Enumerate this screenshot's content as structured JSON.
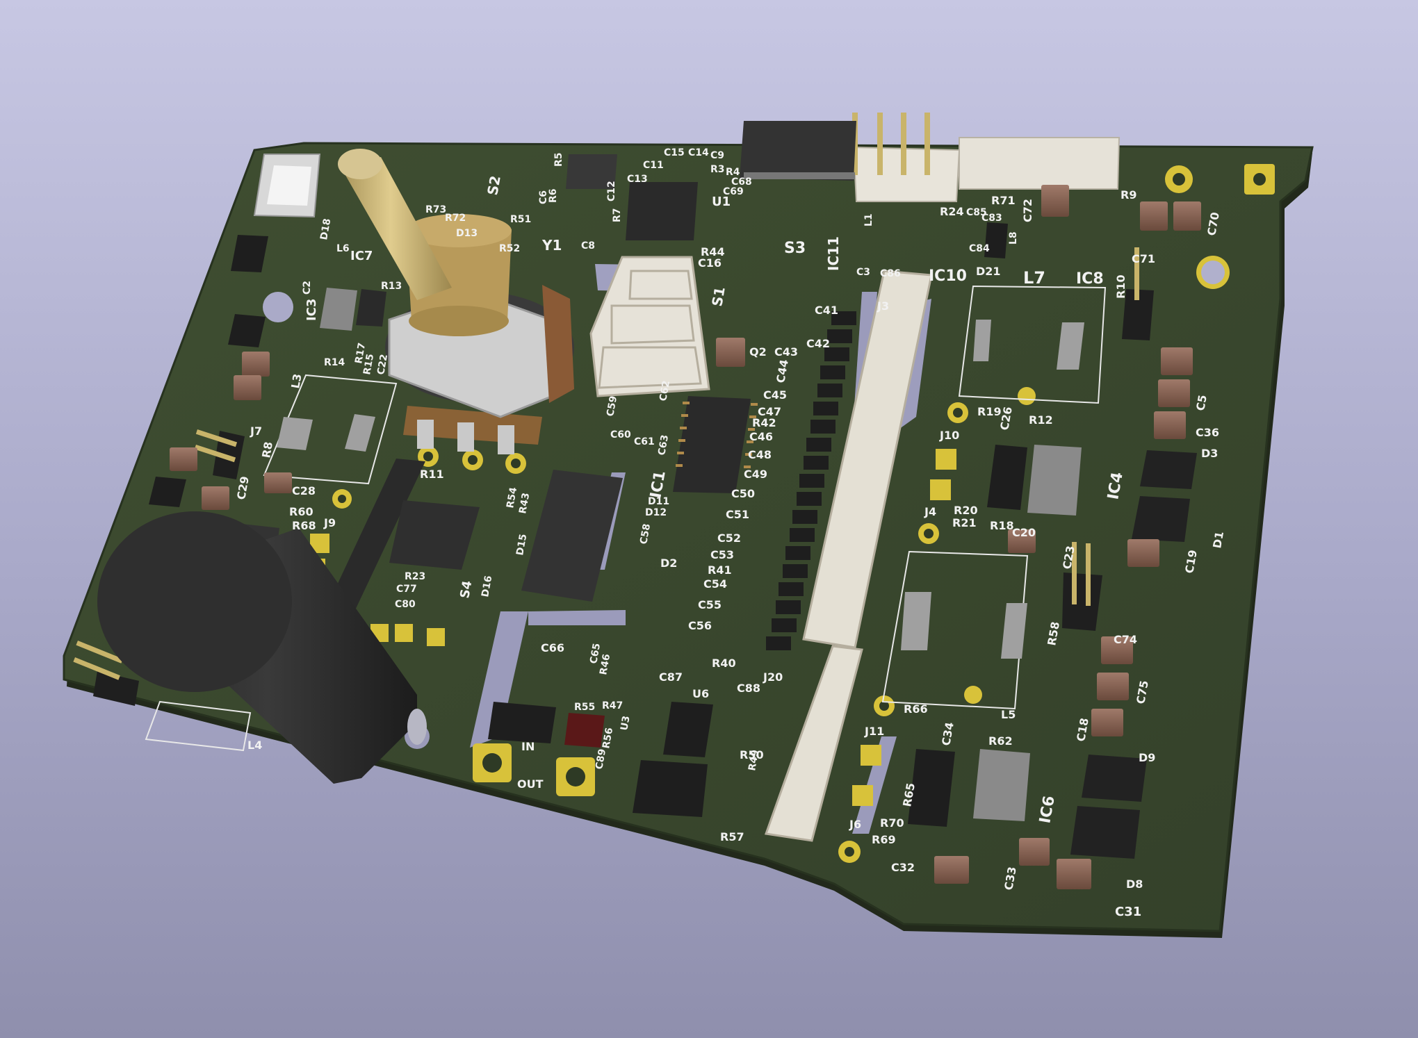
{
  "scene": {
    "subject": "",
    "colors": {
      "background_top": "#c7c7e3",
      "background_bottom": "#8f8fad",
      "board": "#3b4a2e",
      "board_edge": "#27321f",
      "silkscreen": "#f2f2f2",
      "pad_gold": "#d8c23a",
      "connector_white": "#e8e4da",
      "ic_black": "#2a2a2a",
      "capacitor_brown": "#7a5a4a",
      "knob_brass": "#c8b47a",
      "cylinder_black": "#2b2b2b"
    }
  },
  "silkscreen_labels": [
    "S2",
    "R5",
    "C15",
    "C14",
    "C9",
    "C11",
    "C13",
    "C12",
    "R3",
    "R4",
    "C68",
    "C69",
    "U1",
    "R73",
    "R72",
    "D13",
    "R51",
    "R52",
    "Y1",
    "C8",
    "R7",
    "R6",
    "C6",
    "R44",
    "C16",
    "S3",
    "IC11",
    "C3",
    "C86",
    "IC10",
    "D21",
    "L7",
    "IC8",
    "R71",
    "R24",
    "C85",
    "C83",
    "C72",
    "C84",
    "R9",
    "C70",
    "C71",
    "R10",
    "L1",
    "L8",
    "D18",
    "IC7",
    "L6",
    "IC3",
    "C2",
    "R13",
    "R14",
    "R17",
    "R15",
    "C22",
    "L3",
    "R8",
    "J7",
    "C29",
    "C28",
    "R60",
    "R68",
    "J9",
    "S1",
    "Q2",
    "C43",
    "C41",
    "C42",
    "C44",
    "C45",
    "C47",
    "R42",
    "C46",
    "C48",
    "C49",
    "C50",
    "C51",
    "C52",
    "C53",
    "R41",
    "C54",
    "C55",
    "C56",
    "R40",
    "J3",
    "C59",
    "C60",
    "C61",
    "C62",
    "C63",
    "IC1",
    "D11",
    "D12",
    "C58",
    "D2",
    "R11",
    "R54",
    "R43",
    "S4",
    "D16",
    "D15",
    "R23",
    "C77",
    "C80",
    "R19",
    "C26",
    "R12",
    "J10",
    "IC4",
    "R20",
    "R21",
    "R18",
    "C20",
    "J4",
    "C5",
    "C36",
    "D3",
    "D1",
    "C19",
    "C23",
    "R58",
    "L5",
    "C66",
    "C65",
    "R46",
    "R55",
    "R47",
    "U3",
    "R56",
    "C89",
    "IN",
    "OUT",
    "C87",
    "U6",
    "C88",
    "R50",
    "R49",
    "J20",
    "R57",
    "R66",
    "C34",
    "R62",
    "J11",
    "R65",
    "IC6",
    "R70",
    "R69",
    "J6",
    "C32",
    "C33",
    "C31",
    "D8",
    "D9",
    "C18",
    "C74",
    "C75",
    "L4"
  ]
}
